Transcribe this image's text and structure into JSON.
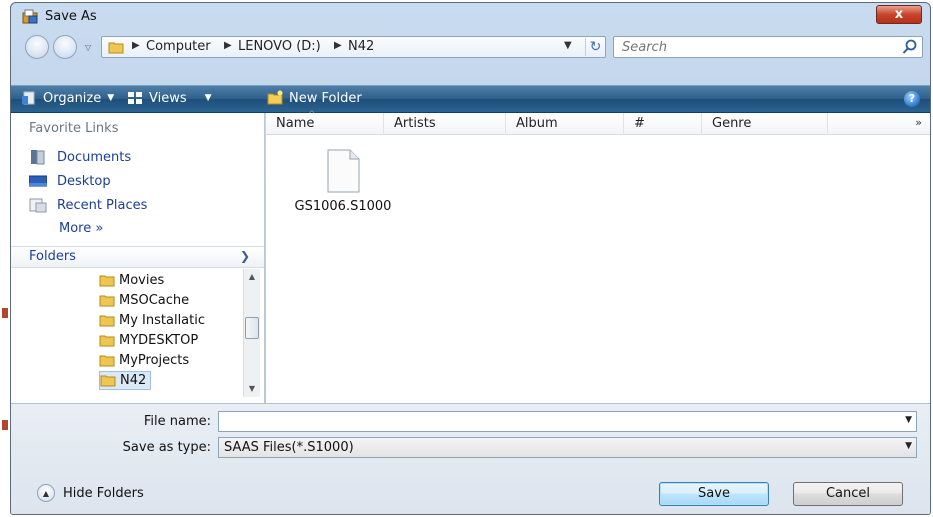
{
  "colors": {
    "toolbar": "#2d5f8b",
    "link": "#1c3f94",
    "close": "#c8442b",
    "frame": "#b7cde6"
  },
  "window": {
    "title": "Save As",
    "close_glyph": "x"
  },
  "address": {
    "crumbs": [
      "Computer",
      "LENOVO (D:)",
      "N42"
    ],
    "search_placeholder": "Search"
  },
  "toolbar": {
    "organize": "Organize",
    "views": "Views",
    "new_folder": "New Folder",
    "help": "?"
  },
  "nav": {
    "favorites_title": "Favorite Links",
    "favorites": [
      {
        "label": "Documents",
        "icon": "documents-icon"
      },
      {
        "label": "Desktop",
        "icon": "desktop-icon"
      },
      {
        "label": "Recent Places",
        "icon": "recent-places-icon"
      }
    ],
    "more": "More  »",
    "folders_label": "Folders",
    "folders": [
      {
        "label": "Movies",
        "selected": false
      },
      {
        "label": "MSOCache",
        "selected": false
      },
      {
        "label": "My Installatic",
        "selected": false
      },
      {
        "label": "MYDESKTOP",
        "selected": false
      },
      {
        "label": "MyProjects",
        "selected": false
      },
      {
        "label": "N42",
        "selected": true
      }
    ]
  },
  "columns": [
    "Name",
    "Artists",
    "Album",
    "#",
    "Genre"
  ],
  "more_columns": "»",
  "files": [
    {
      "name": "GS1006.S1000",
      "icon": "generic-file-icon"
    }
  ],
  "form": {
    "file_name_label": "File name:",
    "file_name_value": "",
    "save_type_label": "Save as type:",
    "save_type_value": "SAAS Files(*.S1000)"
  },
  "footer": {
    "hide_folders": "Hide Folders",
    "save": "Save",
    "cancel": "Cancel"
  }
}
